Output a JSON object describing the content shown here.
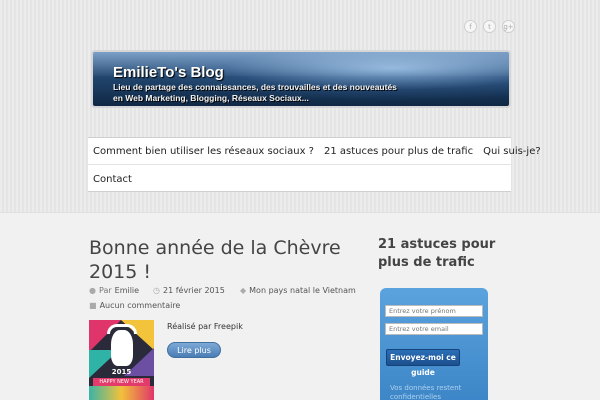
{
  "social": {
    "icons": [
      "facebook-icon",
      "twitter-icon",
      "google-plus-icon"
    ],
    "glyphs": [
      "f",
      "t",
      "g+"
    ]
  },
  "header": {
    "blog_title": "EmilieTo's Blog",
    "tagline_line1": "Lieu de partage des connaissances, des trouvailles et des nouveautés",
    "tagline_line2": "en Web Marketing, Blogging, Réseaux Sociaux..."
  },
  "nav": {
    "items": [
      {
        "label": "Comment bien utiliser les réseaux sociaux ?"
      },
      {
        "label": "21 astuces pour plus de trafic"
      },
      {
        "label": "Qui suis-je?"
      },
      {
        "label": "Contact"
      }
    ]
  },
  "post": {
    "title": "Bonne année de la Chèvre 2015 !",
    "author_prefix": "Par",
    "author": "Emilie",
    "date": "21 février 2015",
    "category": "Mon pays natal le Vietnam",
    "comments": "Aucun commentaire",
    "excerpt": "Réalisé par Freepik",
    "read_more": "Lire plus",
    "thumb_year": "2015",
    "thumb_caption": "HAPPY NEW YEAR"
  },
  "sidebar": {
    "widget_title": "21 astuces pour plus de trafic",
    "firstname_placeholder": "Entrez votre prénom",
    "email_placeholder": "Entrez votre email",
    "submit_label": "Envoyez-moi ce guide",
    "privacy_note": "Vos données restent confidentielles"
  },
  "colors": {
    "accent_blue": "#3d86c7",
    "button_blue": "#1b4f8c",
    "banner_blue": "#22476f"
  }
}
